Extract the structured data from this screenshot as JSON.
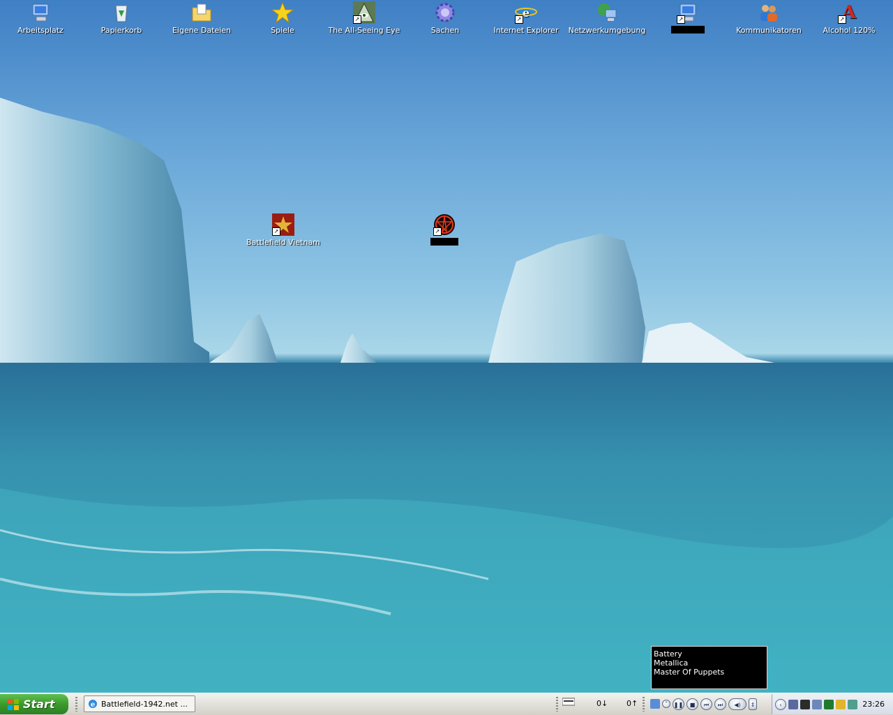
{
  "desktop": {
    "icons_top": [
      {
        "label": "Arbeitsplatz",
        "icon": "my-computer-icon"
      },
      {
        "label": "Papierkorb",
        "icon": "recycle-bin-icon"
      },
      {
        "label": "Eigene Dateien",
        "icon": "my-documents-icon"
      },
      {
        "label": "Spiele",
        "icon": "star-icon"
      },
      {
        "label": "The All-Seeing Eye",
        "icon": "all-seeing-eye-icon"
      },
      {
        "label": "Sachen",
        "icon": "gear-folder-icon"
      },
      {
        "label": "Internet Explorer",
        "icon": "internet-explorer-icon"
      },
      {
        "label": "Netzwerkumgebung",
        "icon": "network-places-icon"
      },
      {
        "label": "",
        "icon": "computer-icon"
      },
      {
        "label": "Kommunikatoren",
        "icon": "users-icon"
      },
      {
        "label": "Alcohol 120%",
        "icon": "alcohol-120-icon"
      }
    ],
    "icons_middle": [
      {
        "label": "Battlefield Vietnam",
        "icon": "battlefield-vietnam-icon"
      },
      {
        "label": "",
        "icon": "pentagram-icon"
      }
    ]
  },
  "now_playing": {
    "track": "Battery",
    "artist": "Metallica",
    "album": "Master Of Puppets"
  },
  "taskbar": {
    "start_label": "Start",
    "window_button_label": "Battlefield-1942.net ...",
    "net_down": "0↓",
    "net_up": "0↑",
    "clock": "23:26"
  },
  "colors": {
    "start_green": "#3a9a2c",
    "osd_background": "#000000",
    "icon_label": "#ffffff"
  }
}
